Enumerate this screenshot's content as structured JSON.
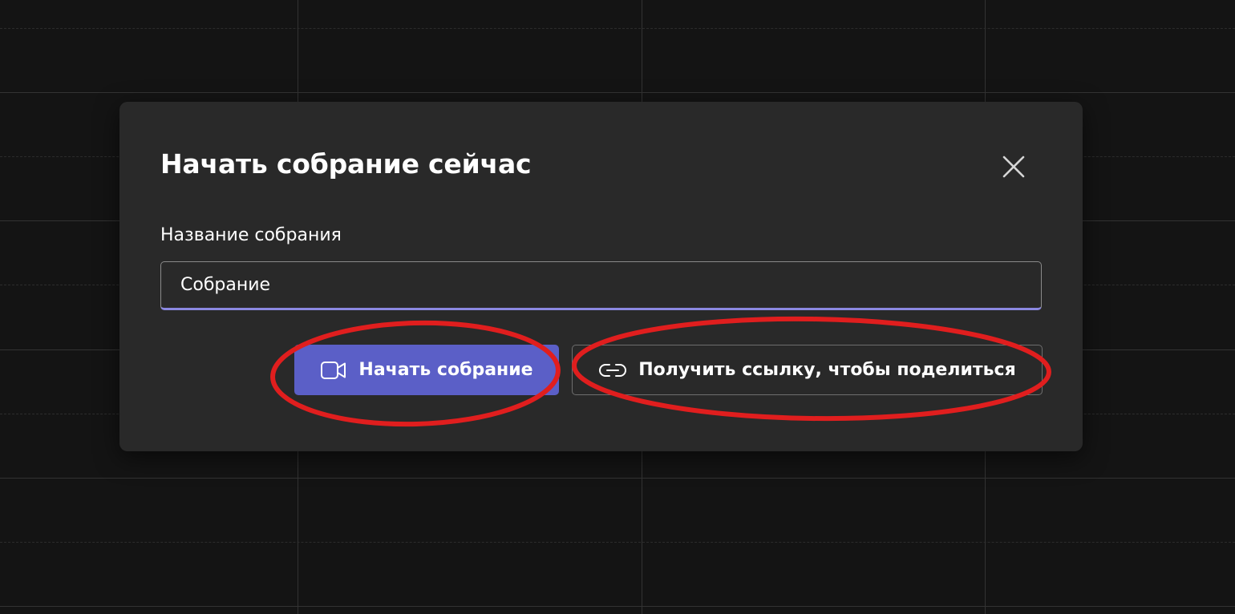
{
  "dialog": {
    "title": "Начать собрание сейчас",
    "field_label": "Название собрания",
    "meeting_name_value": "Собрание",
    "start_button_label": "Начать собрание",
    "share_link_button_label": "Получить ссылку, чтобы поделиться",
    "close_icon": "close-icon",
    "video_icon": "video-camera-icon",
    "link_icon": "link-icon"
  },
  "colors": {
    "background": "#141414",
    "dialog": "#292929",
    "accent": "#5b5fc7",
    "input_focus_underline": "#8b88e0",
    "annotation": "#e01e1e"
  }
}
